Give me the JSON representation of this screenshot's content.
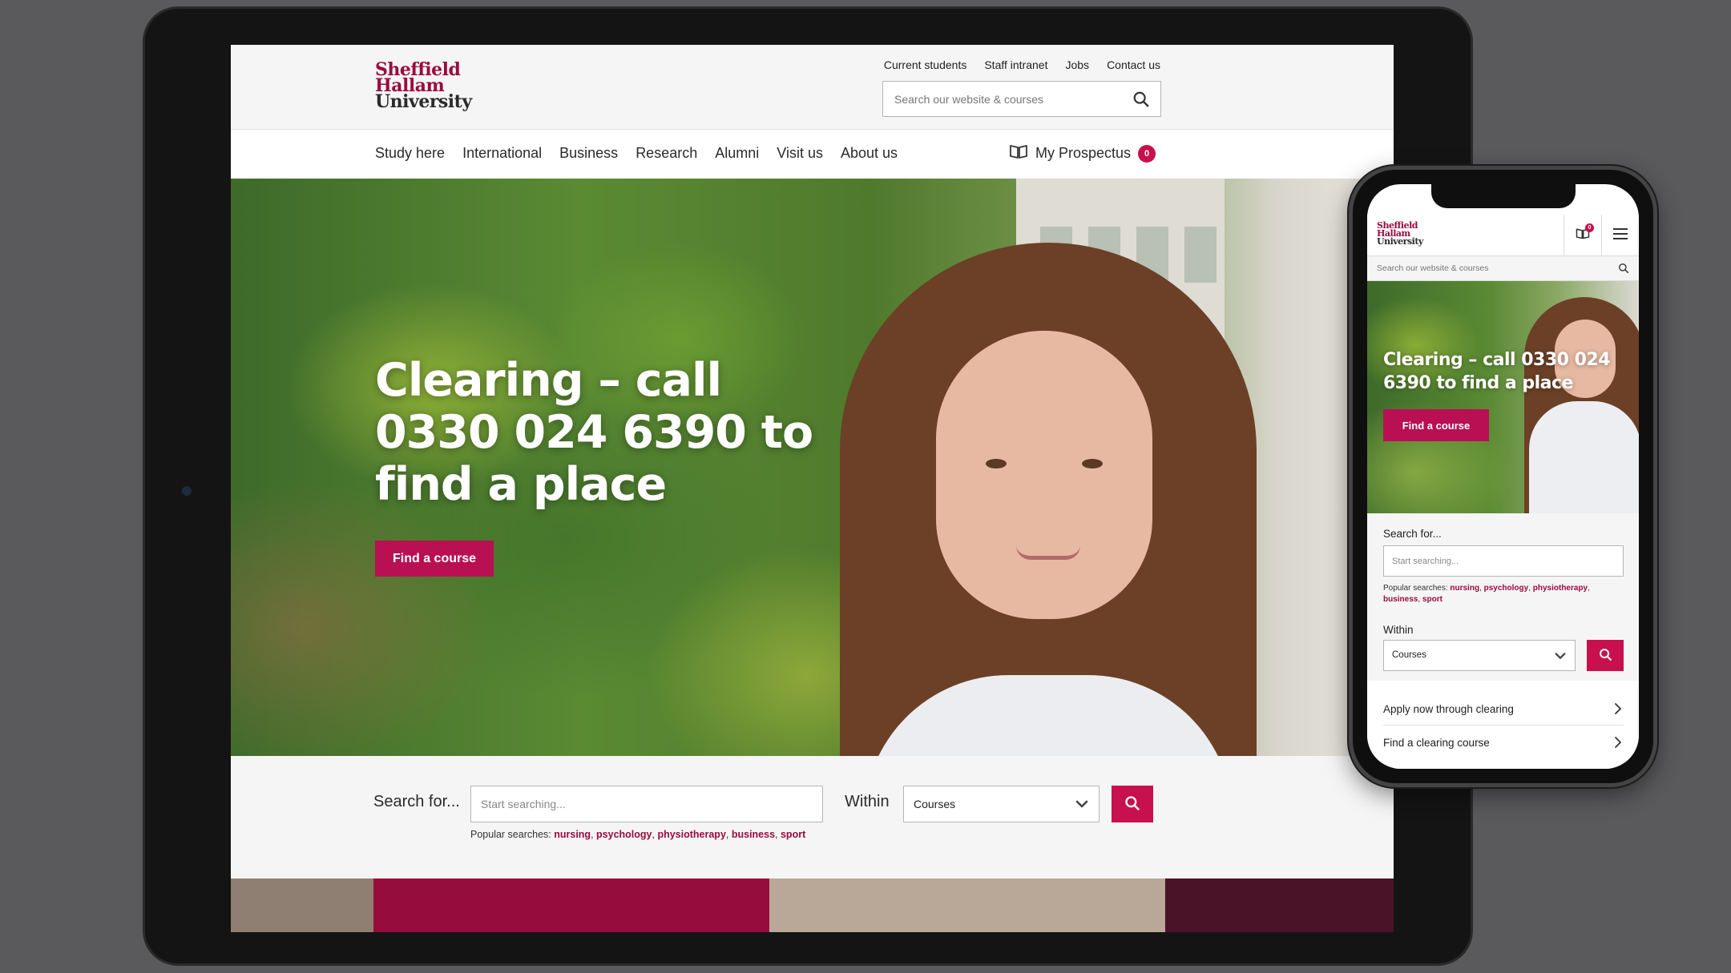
{
  "brand": {
    "logo_lines": [
      "Sheffield",
      "Hallam",
      "University"
    ],
    "accent": "#c8104f",
    "logo_color": "#9a0a3f"
  },
  "desktop": {
    "utility_links": [
      "Current students",
      "Staff intranet",
      "Jobs",
      "Contact us"
    ],
    "search": {
      "placeholder": "Search our website & courses",
      "icon": "search-icon"
    },
    "nav": [
      "Study here",
      "International",
      "Business",
      "Research",
      "Alumni",
      "Visit us",
      "About us"
    ],
    "prospectus": {
      "label": "My Prospectus",
      "count": "0",
      "icon": "book-icon"
    },
    "hero": {
      "heading": "Clearing – call 0330 024 6390 to find a place",
      "cta": "Find a course"
    },
    "search_form": {
      "label": "Search for...",
      "placeholder": "Start searching...",
      "popular_prefix": "Popular searches: ",
      "popular": [
        "nursing",
        "psychology",
        "physiotherapy",
        "business",
        "sport"
      ],
      "within_label": "Within",
      "within_value": "Courses"
    }
  },
  "mobile": {
    "prospectus_count": "0",
    "search": {
      "placeholder": "Search our website & courses"
    },
    "hero": {
      "heading": "Clearing – call 0330 024 6390 to find a place",
      "cta": "Find a course"
    },
    "search_form": {
      "label": "Search for...",
      "placeholder": "Start searching...",
      "popular_prefix": "Popular searches: ",
      "popular": [
        "nursing",
        "psychology",
        "physiotherapy",
        "business",
        "sport"
      ],
      "within_label": "Within",
      "within_value": "Courses"
    },
    "links": [
      "Apply now through clearing",
      "Find a clearing course"
    ]
  }
}
